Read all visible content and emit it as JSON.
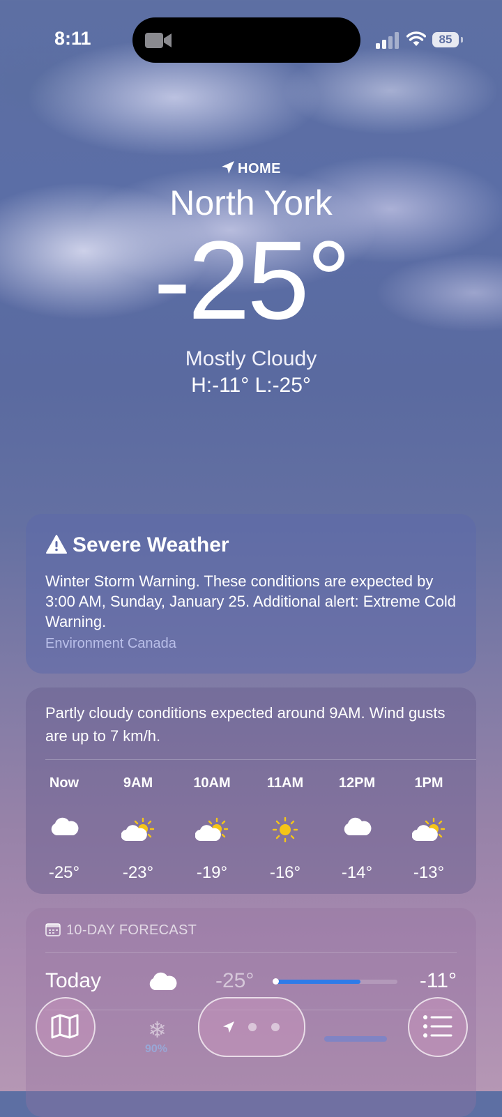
{
  "status_bar": {
    "time": "8:11",
    "battery": "85"
  },
  "location": {
    "label": "HOME",
    "city": "North York",
    "temperature": "-25°",
    "condition": "Mostly Cloudy",
    "hi_lo": "H:-11°  L:-25°"
  },
  "alert": {
    "title": "Severe Weather",
    "text": "Winter Storm Warning. These conditions are expected by 3:00 AM, Sunday, January 25. Additional alert: Extreme Cold Warning.",
    "source": "Environment Canada"
  },
  "hourly": {
    "summary": "Partly cloudy conditions expected around 9AM. Wind gusts are up to 7 km/h.",
    "hours": [
      {
        "label": "Now",
        "icon": "cloud-icon",
        "temp": "-25°"
      },
      {
        "label": "9AM",
        "icon": "partly-sunny-icon",
        "temp": "-23°"
      },
      {
        "label": "10AM",
        "icon": "partly-sunny-icon",
        "temp": "-19°"
      },
      {
        "label": "11AM",
        "icon": "sun-icon",
        "temp": "-16°"
      },
      {
        "label": "12PM",
        "icon": "cloud-icon",
        "temp": "-14°"
      },
      {
        "label": "1PM",
        "icon": "partly-sunny-icon",
        "temp": "-13°"
      }
    ]
  },
  "forecast": {
    "header": "10-DAY FORECAST",
    "today": {
      "day": "Today",
      "icon": "cloud-icon",
      "low": "-25°",
      "high": "-11°",
      "range_fill_fraction": 0.7
    },
    "next": {
      "icon": "snow-icon",
      "precip": "90%"
    }
  },
  "colors": {
    "accent_bar": "#2f7be8",
    "sun": "#f5c518"
  }
}
